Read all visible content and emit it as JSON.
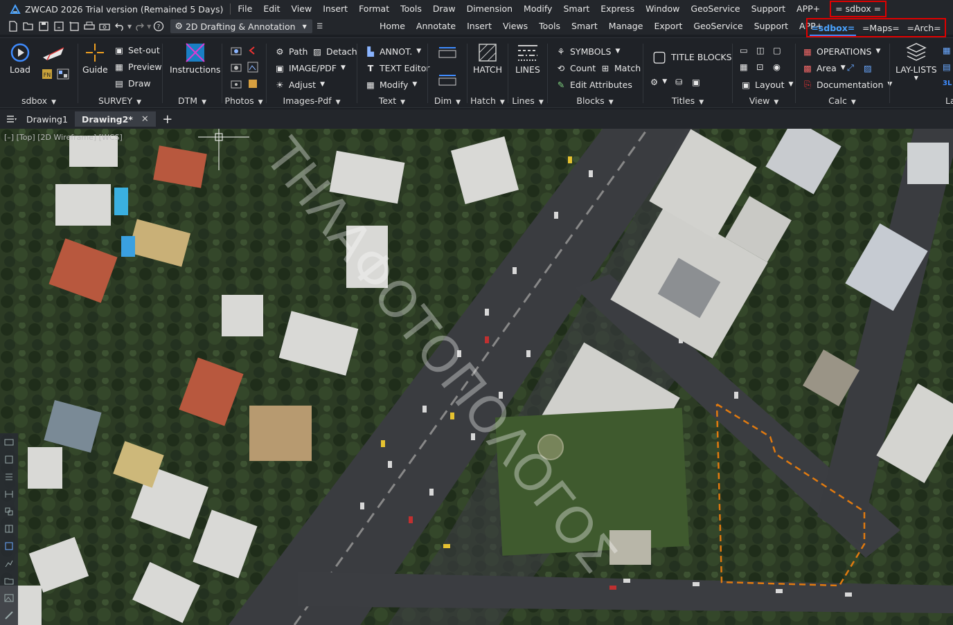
{
  "app": {
    "title": "ZWCAD 2026 Trial version (Remained 5 Days)"
  },
  "menu": {
    "items": [
      "File",
      "Edit",
      "View",
      "Insert",
      "Format",
      "Tools",
      "Draw",
      "Dimension",
      "Modify",
      "Smart",
      "Express",
      "Window",
      "GeoService",
      "Support",
      "APP+"
    ],
    "highlighted": "= sdbox ="
  },
  "qat": {
    "workspace": "2D Drafting & Annotation",
    "help_icon": "question-circle-icon"
  },
  "ribbon_tabs": [
    "Home",
    "Annotate",
    "Insert",
    "Views",
    "Tools",
    "Smart",
    "Manage",
    "Export",
    "GeoService",
    "Support",
    "APP+"
  ],
  "extra_tabs": [
    {
      "label": "=sdbox=",
      "active": true
    },
    {
      "label": "=Maps="
    },
    {
      "label": "=Arch="
    }
  ],
  "ribbon": {
    "sdbox": {
      "title": "sdbox",
      "load": "Load"
    },
    "survey": {
      "title": "SURVEY",
      "guide": "Guide",
      "setout": "Set-out",
      "preview": "Preview",
      "draw": "Draw"
    },
    "dtm": {
      "title": "DTM",
      "instructions": "Instructions"
    },
    "photos": {
      "title": "Photos"
    },
    "images": {
      "title": "Images-Pdf",
      "path": "Path",
      "detach": "Detach",
      "imagepdf": "IMAGE/PDF",
      "adjust": "Adjust"
    },
    "text": {
      "title": "Text",
      "annot": "ANNOT.",
      "editor": "TEXT Editor",
      "modify": "Modify"
    },
    "dim": {
      "title": "Dim"
    },
    "hatch": {
      "title": "Hatch",
      "hatch": "HATCH"
    },
    "lines": {
      "title": "Lines",
      "lines": "LINES"
    },
    "blocks": {
      "title": "Blocks",
      "symbols": "SYMBOLS",
      "count": "Count",
      "match": "Match",
      "edit_attr": "Edit Attributes"
    },
    "titles": {
      "title": "Titles",
      "title_blocks": "TITLE BLOCKS"
    },
    "view": {
      "title": "View",
      "layout": "Layout"
    },
    "calc": {
      "title": "Calc",
      "operations": "OPERATIONS",
      "area": "Area",
      "documentation": "Documentation"
    },
    "layers": {
      "title": "Laye",
      "laylists": "LAY-LISTS"
    }
  },
  "doc_tabs": [
    {
      "label": "Drawing1"
    },
    {
      "label": "Drawing2*",
      "active": true
    }
  ],
  "viewport": {
    "label": "[–] [Top] [2D Wireframe] [WCS]",
    "watermark": "ΤΗΛΑΦΟΤΟΠΟΛΟΓΟΣ"
  },
  "colors": {
    "accent": "#3f8cff",
    "highlight_box": "#e00000",
    "boundary": "#e07a10"
  }
}
